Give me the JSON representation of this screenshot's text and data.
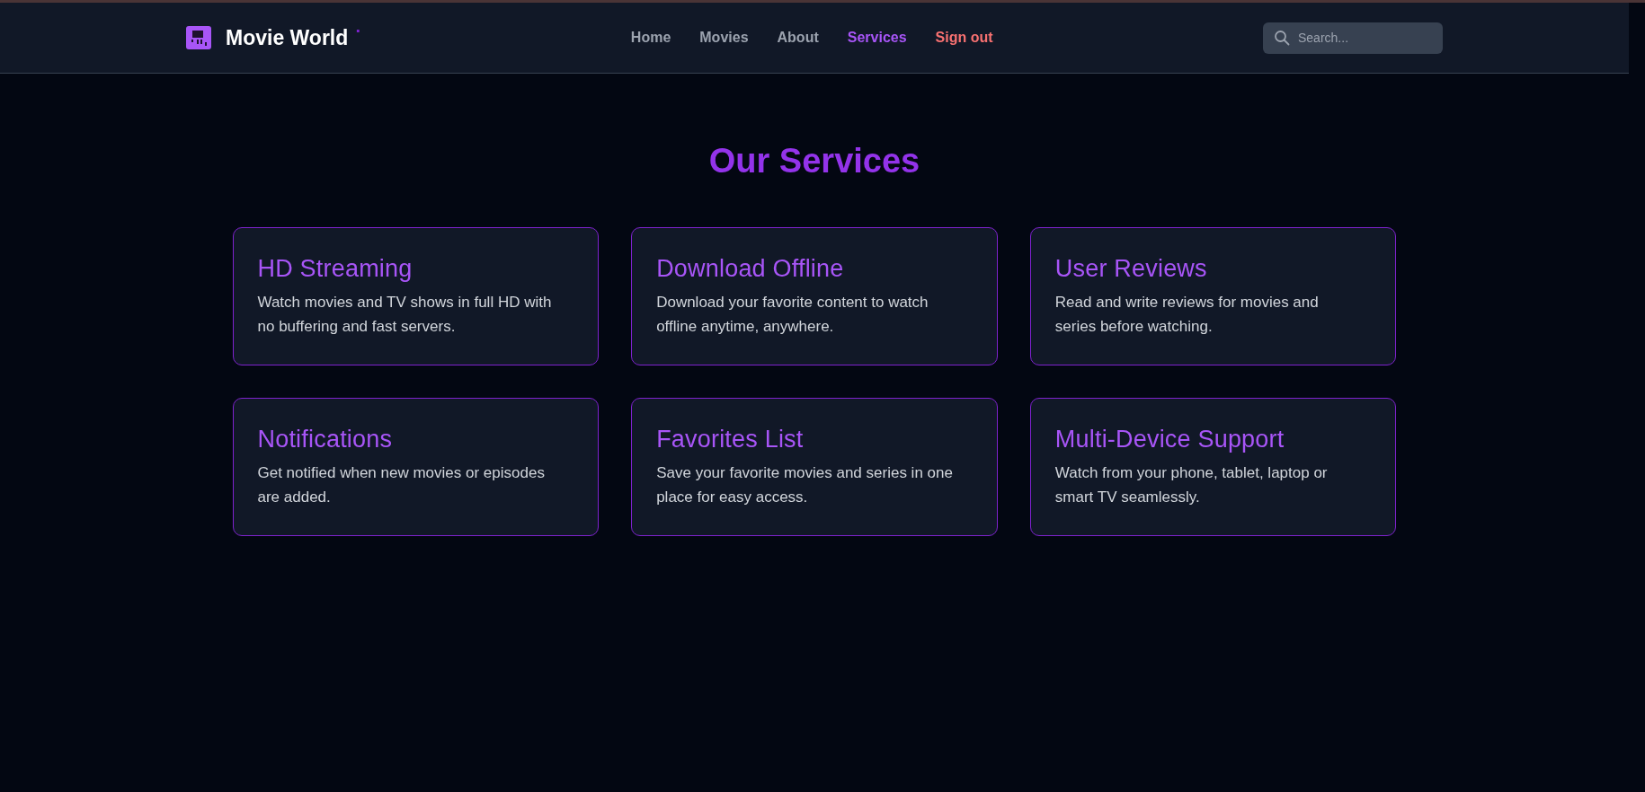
{
  "header": {
    "brand": "Movie World",
    "brand_dot": ".",
    "nav": [
      {
        "label": "Home",
        "kind": "link",
        "selected": false
      },
      {
        "label": "Movies",
        "kind": "link",
        "selected": false
      },
      {
        "label": "About",
        "kind": "link",
        "selected": false
      },
      {
        "label": "Services",
        "kind": "link",
        "selected": true
      },
      {
        "label": "Sign out",
        "kind": "signout",
        "selected": false
      }
    ],
    "search": {
      "placeholder": "Search..."
    }
  },
  "services": {
    "title": "Our Services",
    "cards": [
      {
        "title": "HD Streaming",
        "text": "Watch movies and TV shows in full HD with no buffering and fast servers."
      },
      {
        "title": "Download Offline",
        "text": "Download your favorite content to watch offline anytime, anywhere."
      },
      {
        "title": "User Reviews",
        "text": "Read and write reviews for movies and series before watching."
      },
      {
        "title": "Notifications",
        "text": "Get notified when new movies or episodes are added."
      },
      {
        "title": "Favorites List",
        "text": "Save your favorite movies and series in one place for easy access."
      },
      {
        "title": "Multi-Device Support",
        "text": "Watch from your phone, tablet, laptop or smart TV seamlessly."
      }
    ]
  }
}
